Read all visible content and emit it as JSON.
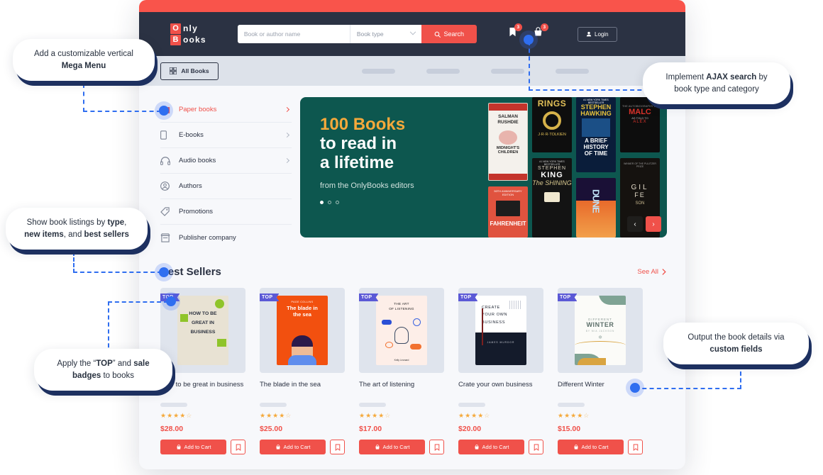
{
  "header": {
    "logo_line1": "nly",
    "logo_line2": "ooks",
    "logo_badge1": "O",
    "logo_badge2": "B",
    "search_placeholder": "Book or author name",
    "booktype_value": "Book type",
    "search_button": "Search",
    "bookmark_badge": "3",
    "cart_badge": "3",
    "login_label": "Login"
  },
  "navbar": {
    "all_books_label": "All Books",
    "placeholder_pills": 4
  },
  "sidebar": {
    "items": [
      {
        "label": "Paper books",
        "icon": "open-book-icon",
        "chevron": true,
        "active": true
      },
      {
        "label": "E-books",
        "icon": "tablet-icon",
        "chevron": true,
        "active": false
      },
      {
        "label": "Audio books",
        "icon": "headphones-icon",
        "chevron": true,
        "active": false
      },
      {
        "label": "Authors",
        "icon": "user-circle-icon",
        "chevron": false,
        "active": false
      },
      {
        "label": "Promotions",
        "icon": "tag-icon",
        "chevron": false,
        "active": false
      },
      {
        "label": "Publisher company",
        "icon": "store-icon",
        "chevron": false,
        "active": false
      }
    ]
  },
  "hero": {
    "line1": "100 Books",
    "line2": "to read in",
    "line3": "a lifetime",
    "subtitle": "from the OnlyBooks editors",
    "slide_count": 3,
    "active_slide": 1,
    "bg_color": "#0d574f",
    "accent_color": "#f5a93b",
    "prev_label": "‹",
    "next_label": "›",
    "covers": [
      {
        "title": "MIDNIGHT'S CHILDREN",
        "author": "SALMAN RUSHDIE"
      },
      {
        "title": "FAHRENHEIT",
        "author": ""
      },
      {
        "title": "RINGS",
        "author": "J·R·R·TOLKIEN"
      },
      {
        "title": "THE SHINING",
        "author": "STEPHEN KING"
      },
      {
        "title": "A BRIEF HISTORY OF TIME",
        "author": "STEPHEN HAWKING"
      },
      {
        "title": "DUNE",
        "author": ""
      },
      {
        "title": "MALCOLM X",
        "author": "ALEX"
      },
      {
        "title": "GILEAD",
        "author": ""
      }
    ]
  },
  "best_sellers": {
    "title": "Best Sellers",
    "see_all_label": "See All",
    "products": [
      {
        "title": "How to be great in business",
        "price": "$28.00",
        "rating": 4,
        "badge": "TOP",
        "cover_title": "HOW TO BE GREAT IN BUSINESS",
        "cover_bg": "#e8e2d3",
        "add_to_cart": "Add to Cart"
      },
      {
        "title": "The blade in the sea",
        "price": "$25.00",
        "rating": 4,
        "badge": "TOP",
        "cover_title": "The blade in the sea",
        "cover_bg": "#f2500f",
        "add_to_cart": "Add to Cart"
      },
      {
        "title": "The art of listening",
        "price": "$17.00",
        "rating": 4,
        "badge": "TOP",
        "cover_title": "THE ART OF LISTENING",
        "cover_bg": "#fdeee8",
        "add_to_cart": "Add to Cart"
      },
      {
        "title": "Crate your own business",
        "price": "$20.00",
        "rating": 4,
        "badge": "TOP",
        "cover_title": "CREATE YOUR OWN BUSINESS",
        "cover_bg": "#ffffff",
        "add_to_cart": "Add to Cart"
      },
      {
        "title": "Different Winter",
        "price": "$15.00",
        "rating": 4,
        "badge": "TOP",
        "cover_title": "DIFFERENT WINTER",
        "cover_bg": "#fbfbf8",
        "add_to_cart": "Add to Cart"
      }
    ]
  },
  "callouts": [
    {
      "id": "mega-menu",
      "html": "Add a customizable vertical<br><b>Mega Menu</b>"
    },
    {
      "id": "ajax-search",
      "html": "Implement <b>AJAX search</b> by<br>book type and category"
    },
    {
      "id": "book-listings",
      "html": "Show book listings by <b>type</b>,<br><b>new items</b>, and <b>best sellers</b>"
    },
    {
      "id": "top-badges",
      "html": "Apply the “<b>TOP</b>” and <b>sale</b><br><b>badges</b> to books"
    },
    {
      "id": "custom-fields",
      "html": "Output the book details via<br><b>custom fields</b>"
    }
  ],
  "colors": {
    "accent_red": "#f0514a",
    "dark_navy": "#2b3243",
    "hero_green": "#0d574f",
    "badge_purple": "#5b59d6",
    "connector_blue": "#2f6ef0",
    "star_gold": "#f5a93b"
  }
}
